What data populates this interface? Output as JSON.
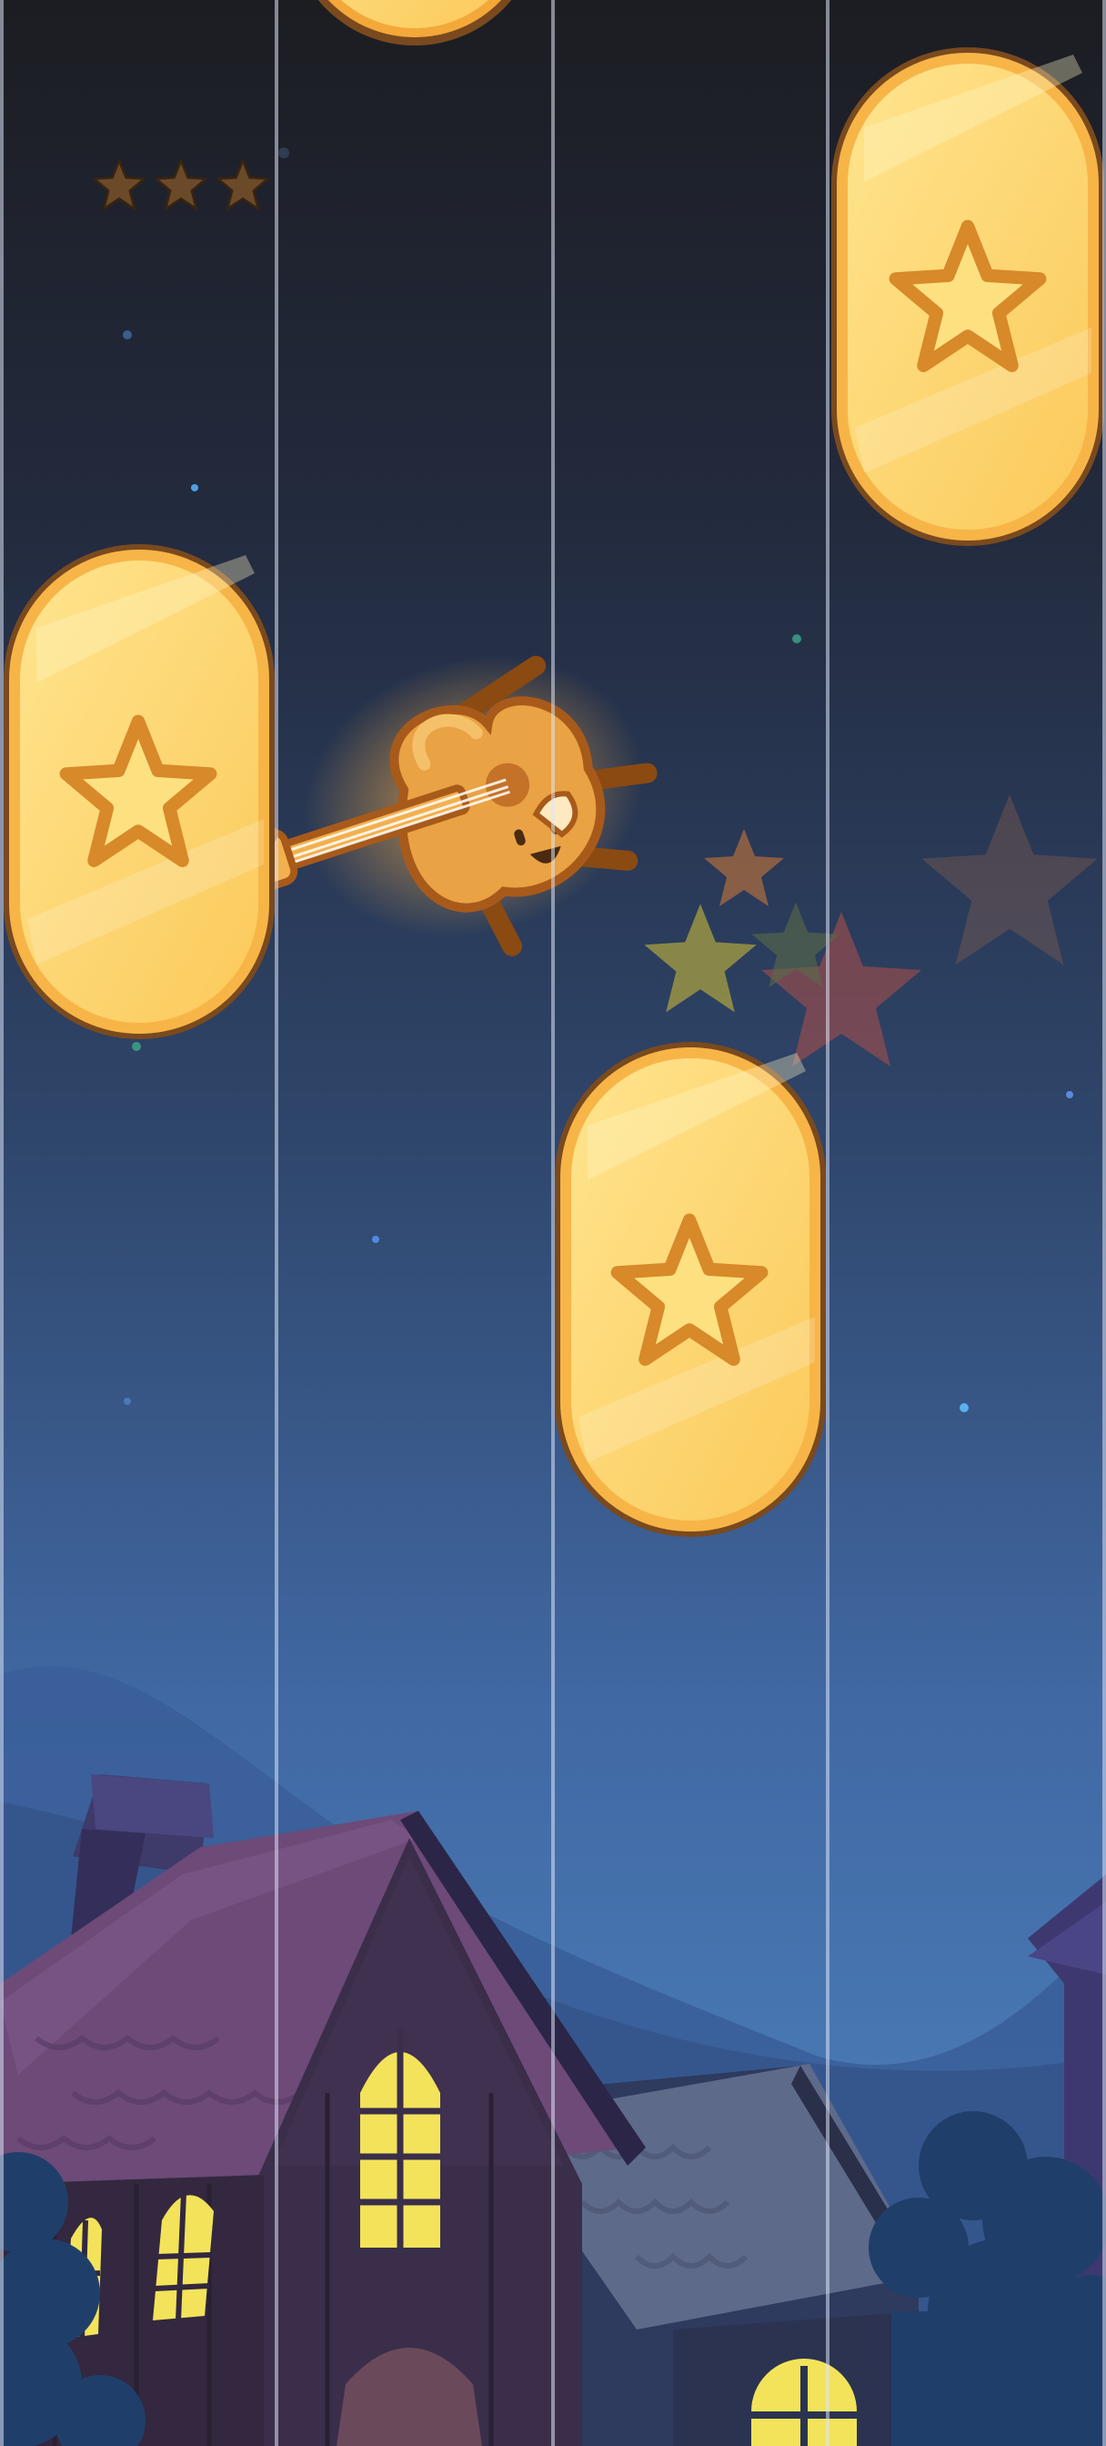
{
  "game": {
    "lanes": 4,
    "progress_stars": {
      "total": 3,
      "earned": 0
    },
    "tiles": [
      {
        "lane": 1,
        "icon": "star-icon",
        "state": "falling"
      },
      {
        "lane": 3,
        "icon": "star-icon",
        "state": "falling"
      },
      {
        "lane": 0,
        "icon": "star-icon",
        "state": "falling"
      },
      {
        "lane": 2,
        "icon": "star-icon",
        "state": "falling"
      }
    ],
    "character": "guitar-character"
  },
  "colors": {
    "sky_top": "#1c1d22",
    "sky_bottom": "#4a7ab8",
    "tile_fill": "#fdd66e",
    "tile_border": "#8a5a2a",
    "lane_divider": "#d8dff0",
    "window_light": "#f3e35a"
  }
}
